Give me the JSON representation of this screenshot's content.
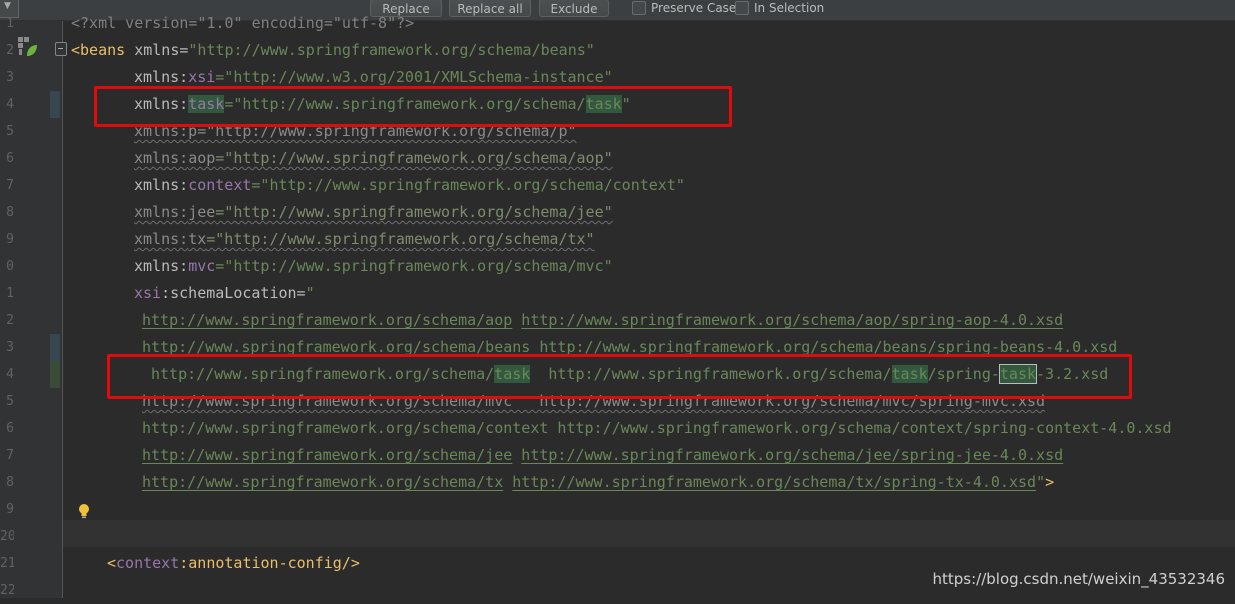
{
  "toolbar": {
    "replace_label": "Replace",
    "replace_all_label": "Replace all",
    "exclude_label": "Exclude",
    "preserve_case_label": "Preserve Case",
    "in_selection_label": "In Selection"
  },
  "gutter": {
    "line_numbers": [
      "1",
      "2",
      "3",
      "4",
      "5",
      "6",
      "7",
      "8",
      "9",
      "0",
      "1",
      "2",
      "3",
      "4",
      "5",
      "6",
      "7",
      "8",
      "9",
      "20",
      "21",
      "22"
    ]
  },
  "code": {
    "l1": "<?xml version=\"1.0\" encoding=\"utf-8\"?>",
    "l2_tag": "<beans",
    "l2_attr": " xmlns=",
    "l2_str": "\"http://www.springframework.org/schema/beans\"",
    "l3_attr": "xmlns:",
    "l3_ns": "xsi",
    "l3_str": "=\"http://www.w3.org/2001/XMLSchema-instance\"",
    "l4_attr": "xmlns:",
    "l4_ns": "task",
    "l4_str_a": "=\"http://www.springframework.org/schema/",
    "l4_str_hl": "task",
    "l4_str_b": "\"",
    "l5": "xmlns:p=\"http://www.springframework.org/schema/p\"",
    "l6_attr": "xmlns:",
    "l6_ns": "aop",
    "l6_str": "=\"http://www.springframework.org/schema/aop\"",
    "l7_attr": "xmlns:",
    "l7_ns": "context",
    "l7_str": "=\"http://www.springframework.org/schema/context\"",
    "l8_attr": "xmlns:",
    "l8_ns": "jee",
    "l8_str": "=\"http://www.springframework.org/schema/jee\"",
    "l9_attr": "xmlns:",
    "l9_ns": "tx",
    "l9_str": "=\"http://www.springframework.org/schema/tx\"",
    "l10_attr": "xmlns:",
    "l10_ns": "mvc",
    "l10_str": "=\"http://www.springframework.org/schema/mvc\"",
    "l11_ns": "xsi",
    "l11_attr": ":schemaLocation=",
    "l11_str": "\"",
    "l12_a": "http://www.springframework.org/schema/aop",
    "l12_b": "http://www.springframework.org/schema/aop/spring-aop-4.0.xsd",
    "l13_a": "http://www.springframework.org/schema/beans",
    "l13_b": "http://www.springframework.org/schema/beans/spring-beans-4.0.xsd",
    "l14_a": "http://www.springframework.org/schema/",
    "l14_hl1": "task",
    "l14_gap": "  http://www.springframework.org/schema/",
    "l14_hl2": "task",
    "l14_mid": "/spring-",
    "l14_hl3": "task",
    "l14_end": "-3.2.xsd",
    "l15": "http://www.springframework.org/schema/mvc   http://www.springframework.org/schema/mvc/spring-mvc.xsd",
    "l16": "http://www.springframework.org/schema/context http://www.springframework.org/schema/context/spring-context-4.0.xsd",
    "l17_a": "http://www.springframework.org/schema/jee",
    "l17_b": "http://www.springframework.org/schema/jee/spring-jee-4.0.xsd",
    "l18_a": "http://www.springframework.org/schema/tx",
    "l18_b": "http://www.springframework.org/schema/tx/spring-tx-4.0.xsd",
    "l18_end_str": "\"",
    "l18_end_tag": ">",
    "l21_tag_a": "<",
    "l21_ns": "context",
    "l21_tag_b": ":annotation-config/>"
  },
  "watermark": "https://blog.csdn.net/weixin_43532346",
  "colors": {
    "background": "#2b2b2b",
    "tag": "#e8bf6a",
    "string": "#6a8759",
    "namespace": "#9876aa",
    "match_highlight": "#32593d",
    "annotation_box": "#e20b0b"
  },
  "icons": [
    "chevron-down-icon",
    "spring-bean-icon",
    "lightbulb-icon",
    "fold-icon"
  ]
}
